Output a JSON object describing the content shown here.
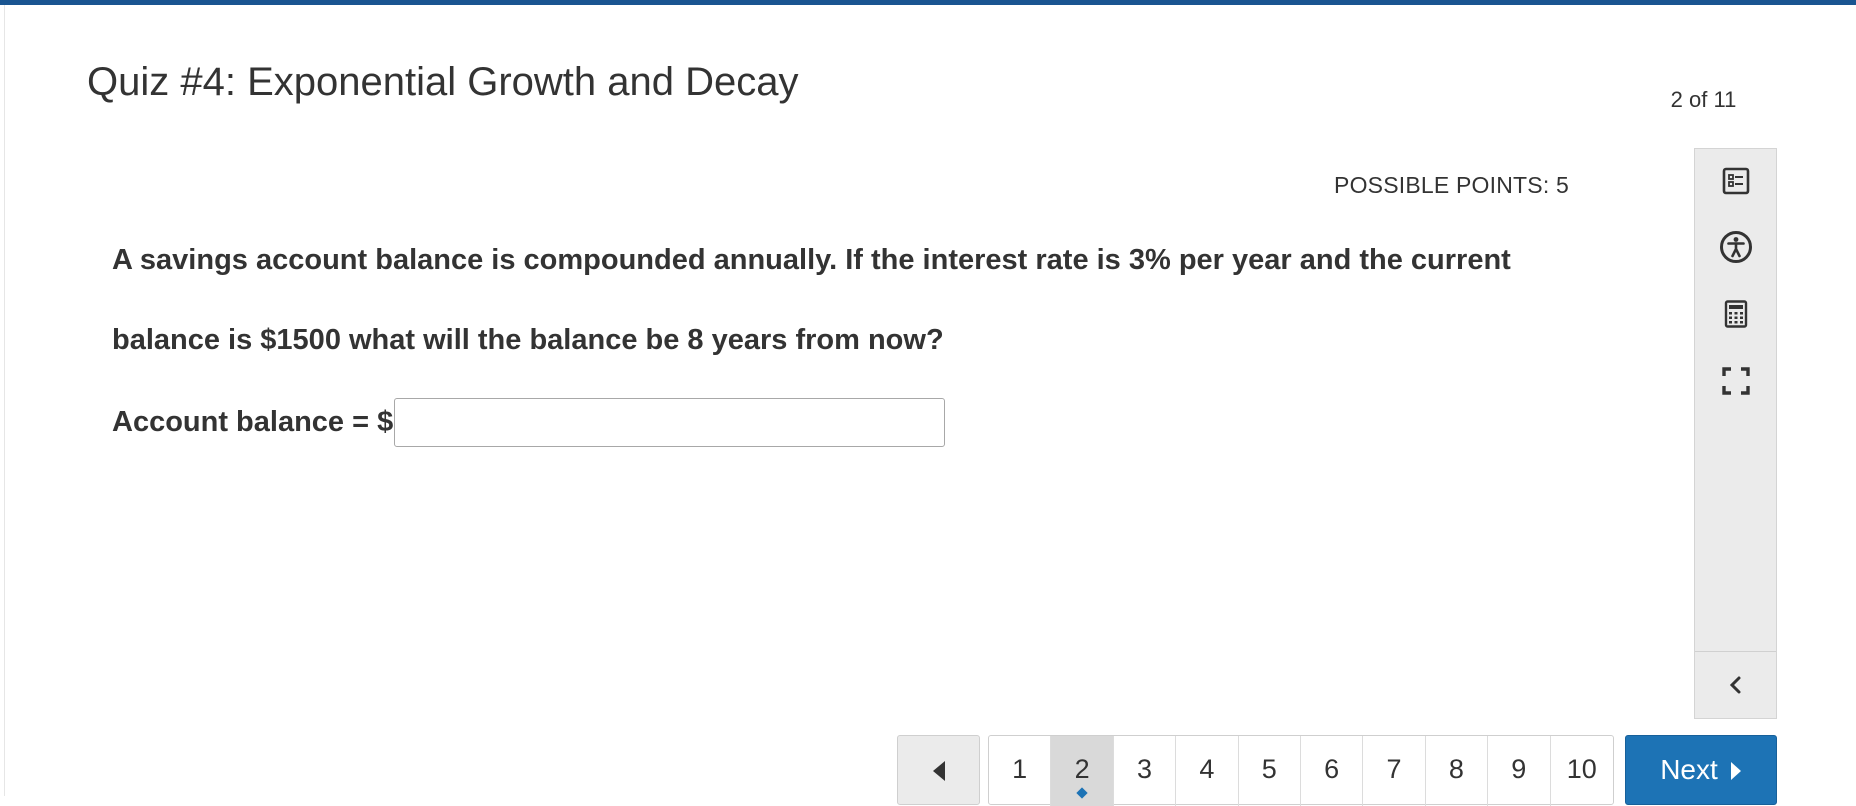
{
  "quiz": {
    "title": "Quiz #4: Exponential Growth and Decay",
    "counter": "2 of 11"
  },
  "question": {
    "points_label": "POSSIBLE POINTS: 5",
    "text": "A savings account balance is compounded annually. If the interest rate is 3% per year and the current balance is $1500 what will the balance be 8 years from now?",
    "answer_label": "Account balance = $",
    "answer_value": "",
    "answer_placeholder": ""
  },
  "tools": [
    {
      "icon": "question-list-icon"
    },
    {
      "icon": "accessibility-icon"
    },
    {
      "icon": "calculator-icon"
    },
    {
      "icon": "fullscreen-icon"
    },
    {
      "icon": "chevron-left-icon"
    }
  ],
  "pager": {
    "pages": [
      "1",
      "2",
      "3",
      "4",
      "5",
      "6",
      "7",
      "8",
      "9",
      "10"
    ],
    "current": "2",
    "next_label": "Next"
  },
  "colors": {
    "accent": "#1d73b5",
    "top_bar": "#1a5591",
    "rail_bg": "#ebebeb"
  }
}
